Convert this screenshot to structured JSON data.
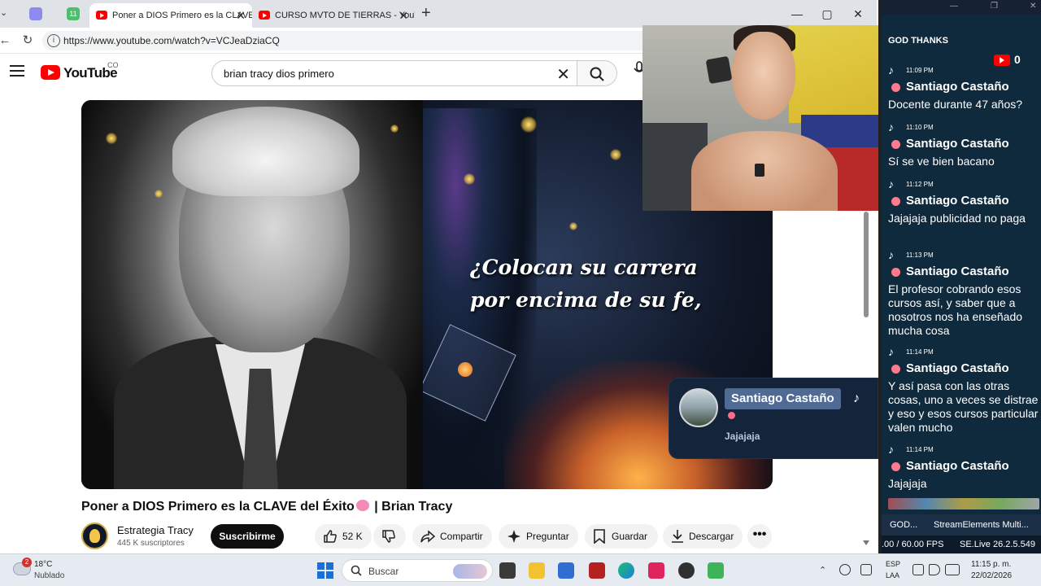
{
  "browser": {
    "tabs": [
      {
        "label": "Poner a DIOS Primero es la CLAVE",
        "active": true
      },
      {
        "label": "CURSO MVTO DE TIERRAS - YouTube",
        "active": false
      }
    ],
    "pinned_badge": "11",
    "new_tab": "+",
    "url": "https://www.youtube.com/watch?v=VCJeaDziaCQ"
  },
  "youtube": {
    "wordmark": "YouTube",
    "country": "CO",
    "search_query": "brian tracy dios primero"
  },
  "video": {
    "caption_line1": "¿Colocan su carrera",
    "caption_line2": "por encima de su fe,",
    "title_main": "Poner a DIOS Primero es la CLAVE del Éxito",
    "title_tail": " | Brian Tracy"
  },
  "channel": {
    "name": "Estrategia Tracy",
    "subscribers": "445 K suscriptores",
    "subscribe_label": "Suscribirme"
  },
  "actions": {
    "likes": "52 K",
    "share": "Compartir",
    "ask": "Preguntar",
    "save": "Guardar",
    "download": "Descargar",
    "more": "•••"
  },
  "notification": {
    "user": "Santiago Castaño",
    "message": "Jajajaja"
  },
  "chat": {
    "title": "GOD THANKS",
    "youtube_count": "0",
    "messages": [
      {
        "time": "11:09 PM",
        "user": "Santiago Castaño",
        "text": "Docente durante 47 años?"
      },
      {
        "time": "11:10 PM",
        "user": "Santiago Castaño",
        "text": "Sí se ve bien bacano"
      },
      {
        "time": "11:12 PM",
        "user": "Santiago Castaño",
        "text": "Jajajaja publicidad no paga"
      },
      {
        "time": "11:13 PM",
        "user": "Santiago Castaño",
        "text": "El profesor cobrando esos cursos así, y saber que a nosotros nos ha enseñado mucha cosa"
      },
      {
        "time": "11:14 PM",
        "user": "Santiago Castaño",
        "text": "Y así pasa con las otras cosas, uno a veces se distrae y eso y esos cursos particular valen mucho"
      },
      {
        "time": "11:14 PM",
        "user": "Santiago Castaño",
        "text": "Jajajaja"
      }
    ],
    "tab1": "GOD...",
    "tab2": "StreamElements Multi...",
    "fps": ".00 / 60.00 FPS",
    "version": "SE.Live 26.2.5.549"
  },
  "taskbar": {
    "weather_badge": "2",
    "temperature": "18°C",
    "weather": "Nublado",
    "search_placeholder": "Buscar",
    "lang1": "ESP",
    "lang2": "LAA",
    "time": "11:15 p. m.",
    "date": "22/02/2026"
  },
  "colors": {
    "youtube_red": "#ff0000",
    "chat_bg": "#0f2a3d",
    "notif_bg": "#13243b"
  }
}
